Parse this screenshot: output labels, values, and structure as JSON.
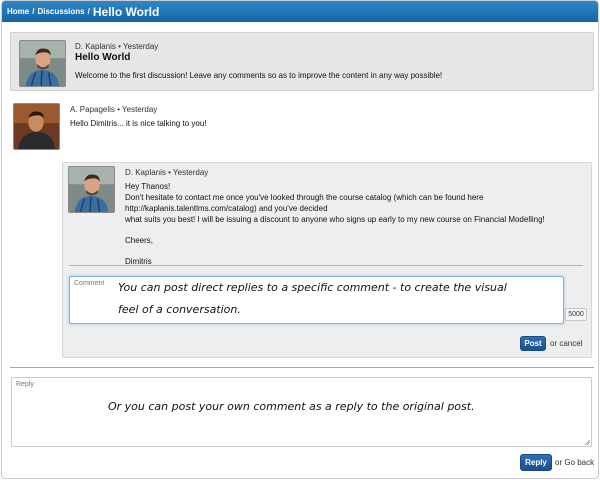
{
  "breadcrumb": {
    "home": "Home",
    "discussions": "Discussions",
    "separator": "/",
    "current": "Hello World"
  },
  "original_post": {
    "author": "D. Kaplanis",
    "time": "Yesterday",
    "meta": "D. Kaplanis • Yesterday",
    "title": "Hello World",
    "body": "Welcome to the first discussion! Leave any comments so as to improve the content in any way possible!"
  },
  "comment": {
    "meta": "A. Papagelis • Yesterday",
    "body": "Hello Dimitris... it is nice talking to you!"
  },
  "nested_reply": {
    "meta": "D. Kaplanis • Yesterday",
    "lines": [
      "Hey Thanos!",
      "Don't hesitate to contact me once you've looked through the course catalog (which can be found here",
      "http://kaplanis.talentlms.com/catalog) and you've decided",
      "what suits you best! I will be issuing a discount to anyone who signs up early to my new course on Financial Modelling!",
      "",
      "Cheers,",
      "",
      "Dimitris"
    ]
  },
  "comment_form": {
    "label": "Comment",
    "value_line1": "You can post direct replies to a specific comment - to create the visual",
    "value_line2": "feel of a conversation.",
    "counter": "5000",
    "post_label": "Post",
    "cancel_text": "or cancel"
  },
  "reply_form": {
    "label": "Reply",
    "value": "Or you can post your own comment as a reply to the original post.",
    "reply_label": "Reply",
    "back_text": "or Go back"
  },
  "colors": {
    "header": "#1a6fb0",
    "button": "#1f5797",
    "focus_border": "#7fb3e0"
  }
}
